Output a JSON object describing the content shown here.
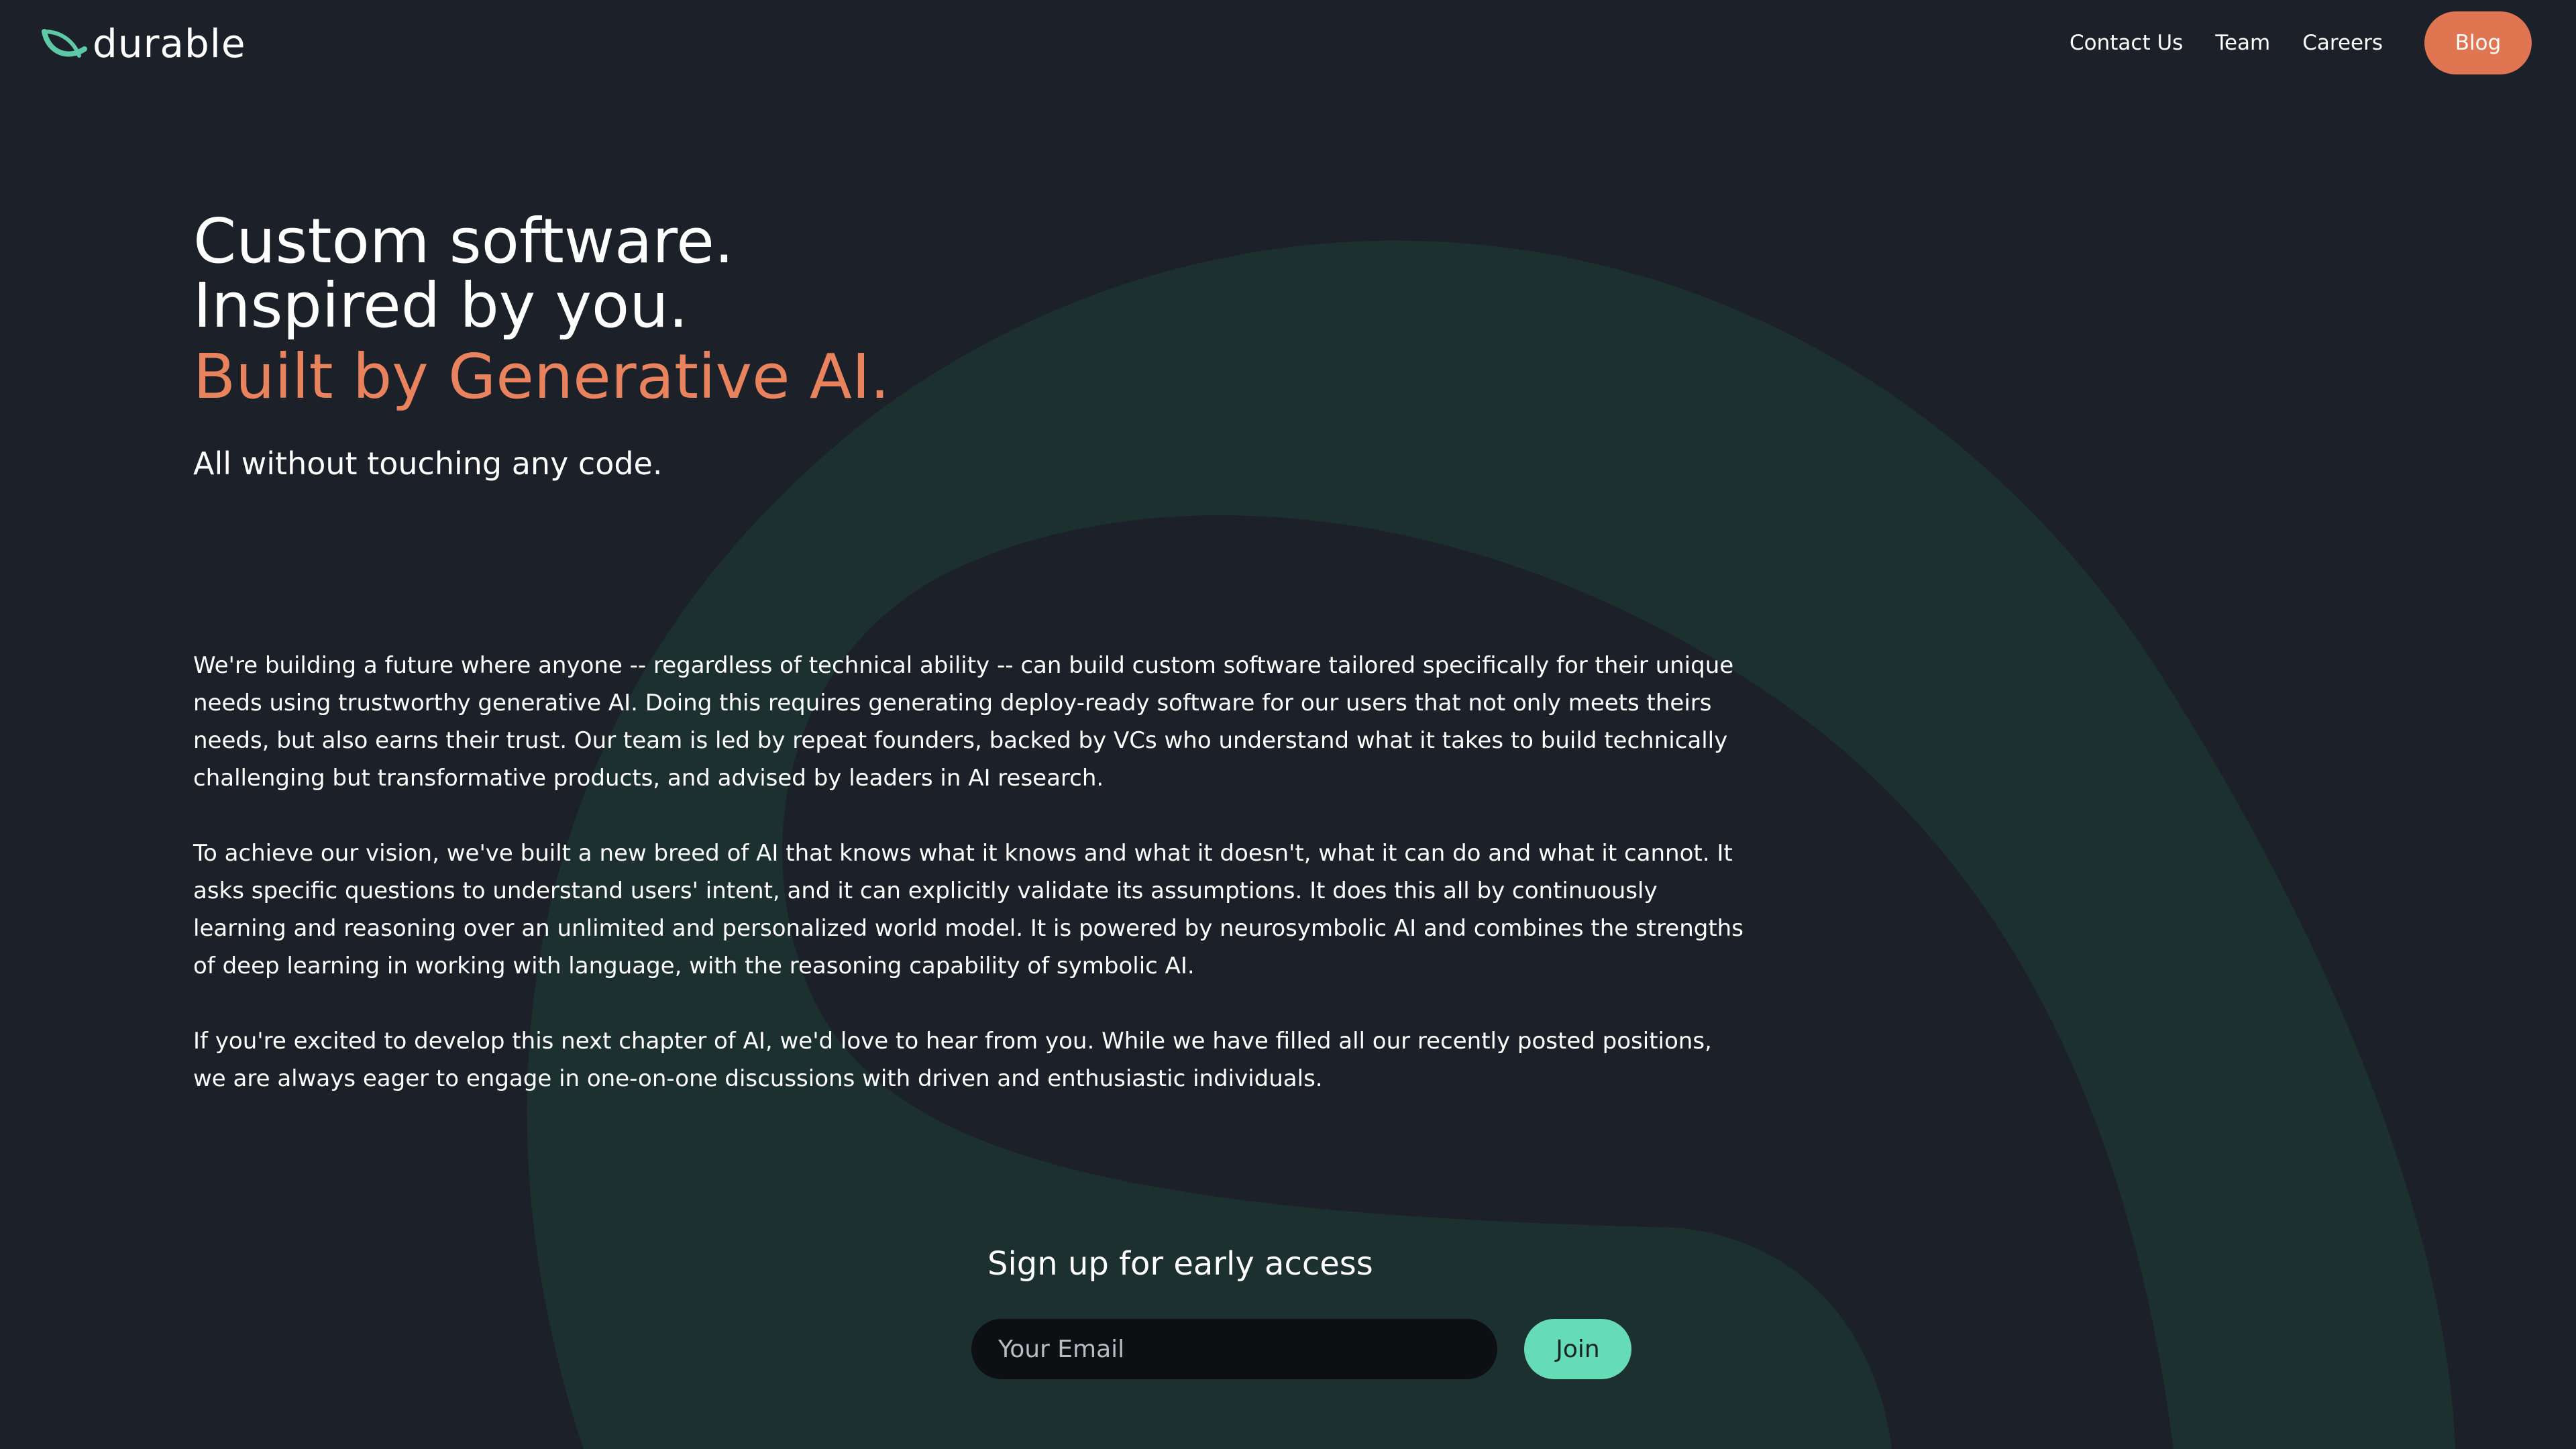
{
  "header": {
    "logo_text": "durable",
    "nav": {
      "contact_label": "Contact Us",
      "team_label": "Team",
      "careers_label": "Careers",
      "blog_label": "Blog"
    }
  },
  "hero": {
    "line1": "Custom software.",
    "line2": "Inspired by you.",
    "line3": "Built by Generative AI.",
    "subtitle": "All without touching any code."
  },
  "body": {
    "paragraphs": [
      "We're building a future where anyone -- regardless of technical ability -- can build custom software tailored specifically for their unique needs using trustworthy generative AI. Doing this requires generating deploy-ready software for our users that not only meets theirs needs, but also earns their trust. Our team is led by repeat founders, backed by VCs who understand what it takes to build technically challenging but transformative products, and advised by leaders in AI research.",
      "To achieve our vision, we've built a new breed of AI that knows what it knows and what it doesn't, what it can do and what it cannot. It asks specific questions to understand users' intent, and it can explicitly validate its assumptions. It does this all by continuously learning and reasoning over an unlimited and personalized world model. It is powered by neurosymbolic AI and combines the strengths of deep learning in working with language, with the reasoning capability of symbolic AI.",
      "If you're excited to develop this next chapter of AI, we'd love to hear from you. While we have filled all our recently posted positions, we are always eager to engage in one-on-one discussions with driven and enthusiastic individuals."
    ]
  },
  "signup": {
    "title": "Sign up for early access",
    "email_placeholder": "Your Email",
    "email_value": "",
    "join_label": "Join"
  },
  "colors": {
    "background": "#1c2028",
    "accent_orange": "#e9835e",
    "blog_button": "#e07552",
    "join_button": "#66dcb6",
    "logo_mark": "#5cc9a7",
    "arc": "#1d3230"
  }
}
